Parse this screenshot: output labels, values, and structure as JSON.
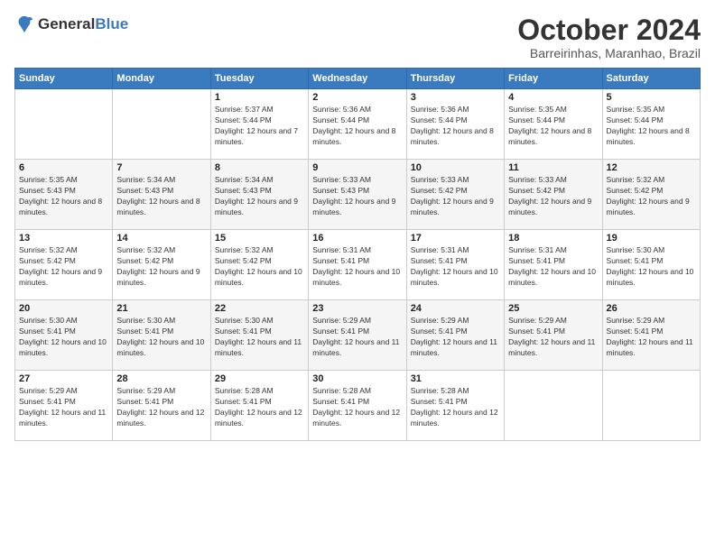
{
  "logo": {
    "general": "General",
    "blue": "Blue"
  },
  "title": "October 2024",
  "subtitle": "Barreirinhas, Maranhao, Brazil",
  "headers": [
    "Sunday",
    "Monday",
    "Tuesday",
    "Wednesday",
    "Thursday",
    "Friday",
    "Saturday"
  ],
  "weeks": [
    [
      {
        "day": "",
        "sunrise": "",
        "sunset": "",
        "daylight": ""
      },
      {
        "day": "",
        "sunrise": "",
        "sunset": "",
        "daylight": ""
      },
      {
        "day": "1",
        "sunrise": "Sunrise: 5:37 AM",
        "sunset": "Sunset: 5:44 PM",
        "daylight": "Daylight: 12 hours and 7 minutes."
      },
      {
        "day": "2",
        "sunrise": "Sunrise: 5:36 AM",
        "sunset": "Sunset: 5:44 PM",
        "daylight": "Daylight: 12 hours and 8 minutes."
      },
      {
        "day": "3",
        "sunrise": "Sunrise: 5:36 AM",
        "sunset": "Sunset: 5:44 PM",
        "daylight": "Daylight: 12 hours and 8 minutes."
      },
      {
        "day": "4",
        "sunrise": "Sunrise: 5:35 AM",
        "sunset": "Sunset: 5:44 PM",
        "daylight": "Daylight: 12 hours and 8 minutes."
      },
      {
        "day": "5",
        "sunrise": "Sunrise: 5:35 AM",
        "sunset": "Sunset: 5:44 PM",
        "daylight": "Daylight: 12 hours and 8 minutes."
      }
    ],
    [
      {
        "day": "6",
        "sunrise": "Sunrise: 5:35 AM",
        "sunset": "Sunset: 5:43 PM",
        "daylight": "Daylight: 12 hours and 8 minutes."
      },
      {
        "day": "7",
        "sunrise": "Sunrise: 5:34 AM",
        "sunset": "Sunset: 5:43 PM",
        "daylight": "Daylight: 12 hours and 8 minutes."
      },
      {
        "day": "8",
        "sunrise": "Sunrise: 5:34 AM",
        "sunset": "Sunset: 5:43 PM",
        "daylight": "Daylight: 12 hours and 9 minutes."
      },
      {
        "day": "9",
        "sunrise": "Sunrise: 5:33 AM",
        "sunset": "Sunset: 5:43 PM",
        "daylight": "Daylight: 12 hours and 9 minutes."
      },
      {
        "day": "10",
        "sunrise": "Sunrise: 5:33 AM",
        "sunset": "Sunset: 5:42 PM",
        "daylight": "Daylight: 12 hours and 9 minutes."
      },
      {
        "day": "11",
        "sunrise": "Sunrise: 5:33 AM",
        "sunset": "Sunset: 5:42 PM",
        "daylight": "Daylight: 12 hours and 9 minutes."
      },
      {
        "day": "12",
        "sunrise": "Sunrise: 5:32 AM",
        "sunset": "Sunset: 5:42 PM",
        "daylight": "Daylight: 12 hours and 9 minutes."
      }
    ],
    [
      {
        "day": "13",
        "sunrise": "Sunrise: 5:32 AM",
        "sunset": "Sunset: 5:42 PM",
        "daylight": "Daylight: 12 hours and 9 minutes."
      },
      {
        "day": "14",
        "sunrise": "Sunrise: 5:32 AM",
        "sunset": "Sunset: 5:42 PM",
        "daylight": "Daylight: 12 hours and 9 minutes."
      },
      {
        "day": "15",
        "sunrise": "Sunrise: 5:32 AM",
        "sunset": "Sunset: 5:42 PM",
        "daylight": "Daylight: 12 hours and 10 minutes."
      },
      {
        "day": "16",
        "sunrise": "Sunrise: 5:31 AM",
        "sunset": "Sunset: 5:41 PM",
        "daylight": "Daylight: 12 hours and 10 minutes."
      },
      {
        "day": "17",
        "sunrise": "Sunrise: 5:31 AM",
        "sunset": "Sunset: 5:41 PM",
        "daylight": "Daylight: 12 hours and 10 minutes."
      },
      {
        "day": "18",
        "sunrise": "Sunrise: 5:31 AM",
        "sunset": "Sunset: 5:41 PM",
        "daylight": "Daylight: 12 hours and 10 minutes."
      },
      {
        "day": "19",
        "sunrise": "Sunrise: 5:30 AM",
        "sunset": "Sunset: 5:41 PM",
        "daylight": "Daylight: 12 hours and 10 minutes."
      }
    ],
    [
      {
        "day": "20",
        "sunrise": "Sunrise: 5:30 AM",
        "sunset": "Sunset: 5:41 PM",
        "daylight": "Daylight: 12 hours and 10 minutes."
      },
      {
        "day": "21",
        "sunrise": "Sunrise: 5:30 AM",
        "sunset": "Sunset: 5:41 PM",
        "daylight": "Daylight: 12 hours and 10 minutes."
      },
      {
        "day": "22",
        "sunrise": "Sunrise: 5:30 AM",
        "sunset": "Sunset: 5:41 PM",
        "daylight": "Daylight: 12 hours and 11 minutes."
      },
      {
        "day": "23",
        "sunrise": "Sunrise: 5:29 AM",
        "sunset": "Sunset: 5:41 PM",
        "daylight": "Daylight: 12 hours and 11 minutes."
      },
      {
        "day": "24",
        "sunrise": "Sunrise: 5:29 AM",
        "sunset": "Sunset: 5:41 PM",
        "daylight": "Daylight: 12 hours and 11 minutes."
      },
      {
        "day": "25",
        "sunrise": "Sunrise: 5:29 AM",
        "sunset": "Sunset: 5:41 PM",
        "daylight": "Daylight: 12 hours and 11 minutes."
      },
      {
        "day": "26",
        "sunrise": "Sunrise: 5:29 AM",
        "sunset": "Sunset: 5:41 PM",
        "daylight": "Daylight: 12 hours and 11 minutes."
      }
    ],
    [
      {
        "day": "27",
        "sunrise": "Sunrise: 5:29 AM",
        "sunset": "Sunset: 5:41 PM",
        "daylight": "Daylight: 12 hours and 11 minutes."
      },
      {
        "day": "28",
        "sunrise": "Sunrise: 5:29 AM",
        "sunset": "Sunset: 5:41 PM",
        "daylight": "Daylight: 12 hours and 12 minutes."
      },
      {
        "day": "29",
        "sunrise": "Sunrise: 5:28 AM",
        "sunset": "Sunset: 5:41 PM",
        "daylight": "Daylight: 12 hours and 12 minutes."
      },
      {
        "day": "30",
        "sunrise": "Sunrise: 5:28 AM",
        "sunset": "Sunset: 5:41 PM",
        "daylight": "Daylight: 12 hours and 12 minutes."
      },
      {
        "day": "31",
        "sunrise": "Sunrise: 5:28 AM",
        "sunset": "Sunset: 5:41 PM",
        "daylight": "Daylight: 12 hours and 12 minutes."
      },
      {
        "day": "",
        "sunrise": "",
        "sunset": "",
        "daylight": ""
      },
      {
        "day": "",
        "sunrise": "",
        "sunset": "",
        "daylight": ""
      }
    ]
  ]
}
